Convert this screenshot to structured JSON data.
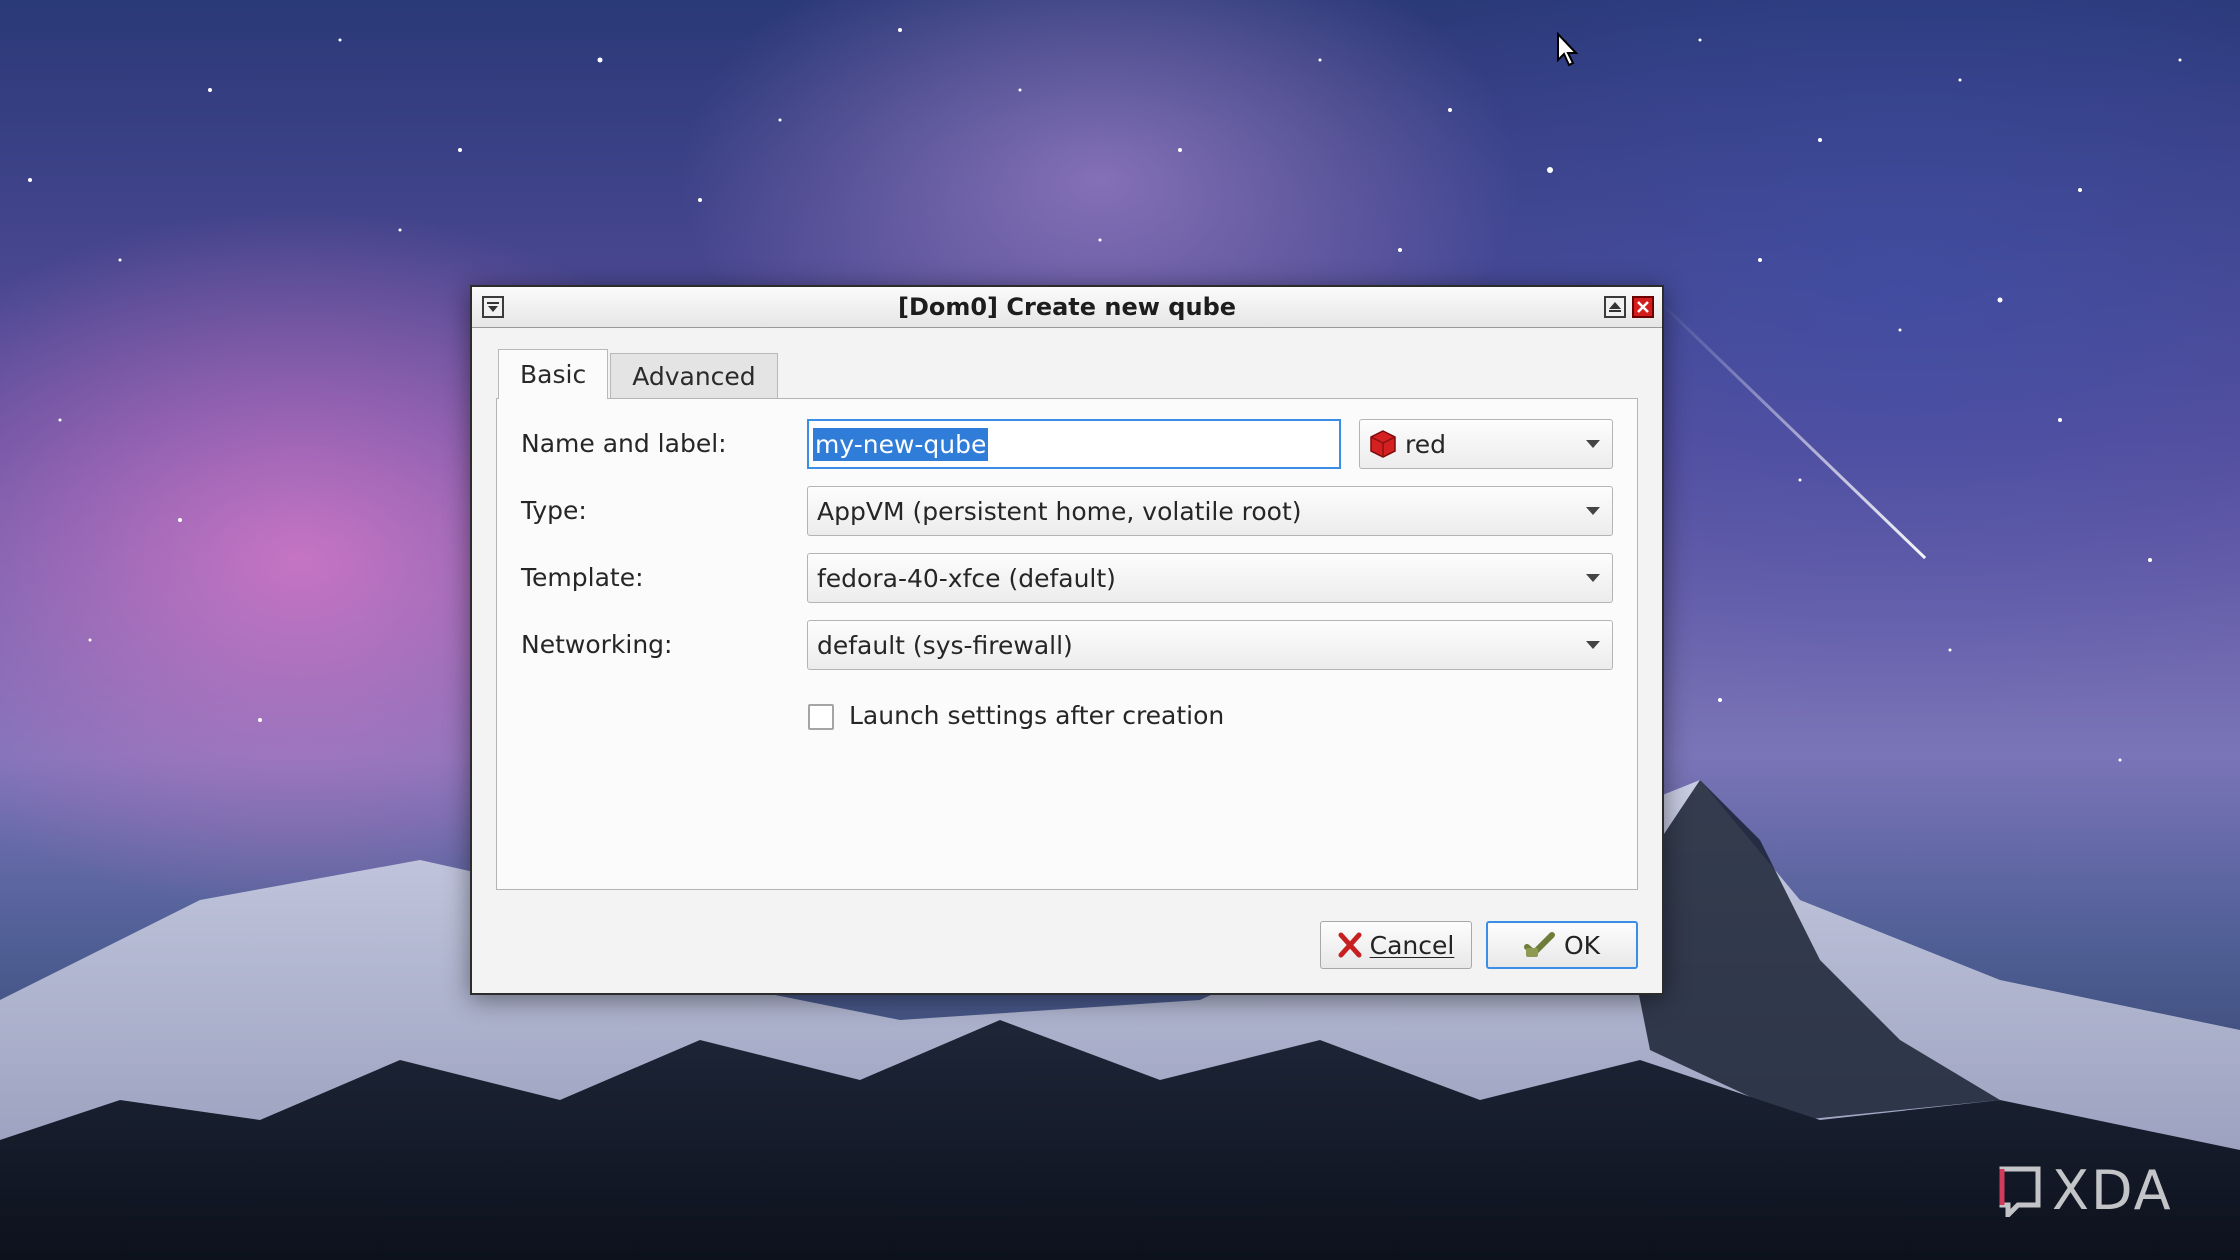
{
  "window": {
    "title": "[Dom0] Create new qube"
  },
  "tabs": [
    {
      "label": "Basic",
      "active": true
    },
    {
      "label": "Advanced",
      "active": false
    }
  ],
  "form": {
    "name_label": "Name and label:",
    "name_value": "my-new-qube",
    "label_color_value": "red",
    "label_color_hex": "#d42020",
    "type_label": "Type:",
    "type_value": "AppVM (persistent home, volatile root)",
    "template_label": "Template:",
    "template_value": "fedora-40-xfce (default)",
    "networking_label": "Networking:",
    "networking_value": "default (sys-firewall)",
    "launch_settings_label": "Launch settings after creation",
    "launch_settings_checked": false
  },
  "buttons": {
    "cancel_label": "Cancel",
    "ok_label": "OK"
  },
  "watermark": {
    "text": "XDA"
  },
  "colors": {
    "selection": "#2f7dd9",
    "focus_border": "#3a8ee6",
    "close_button": "#d41c1c"
  }
}
